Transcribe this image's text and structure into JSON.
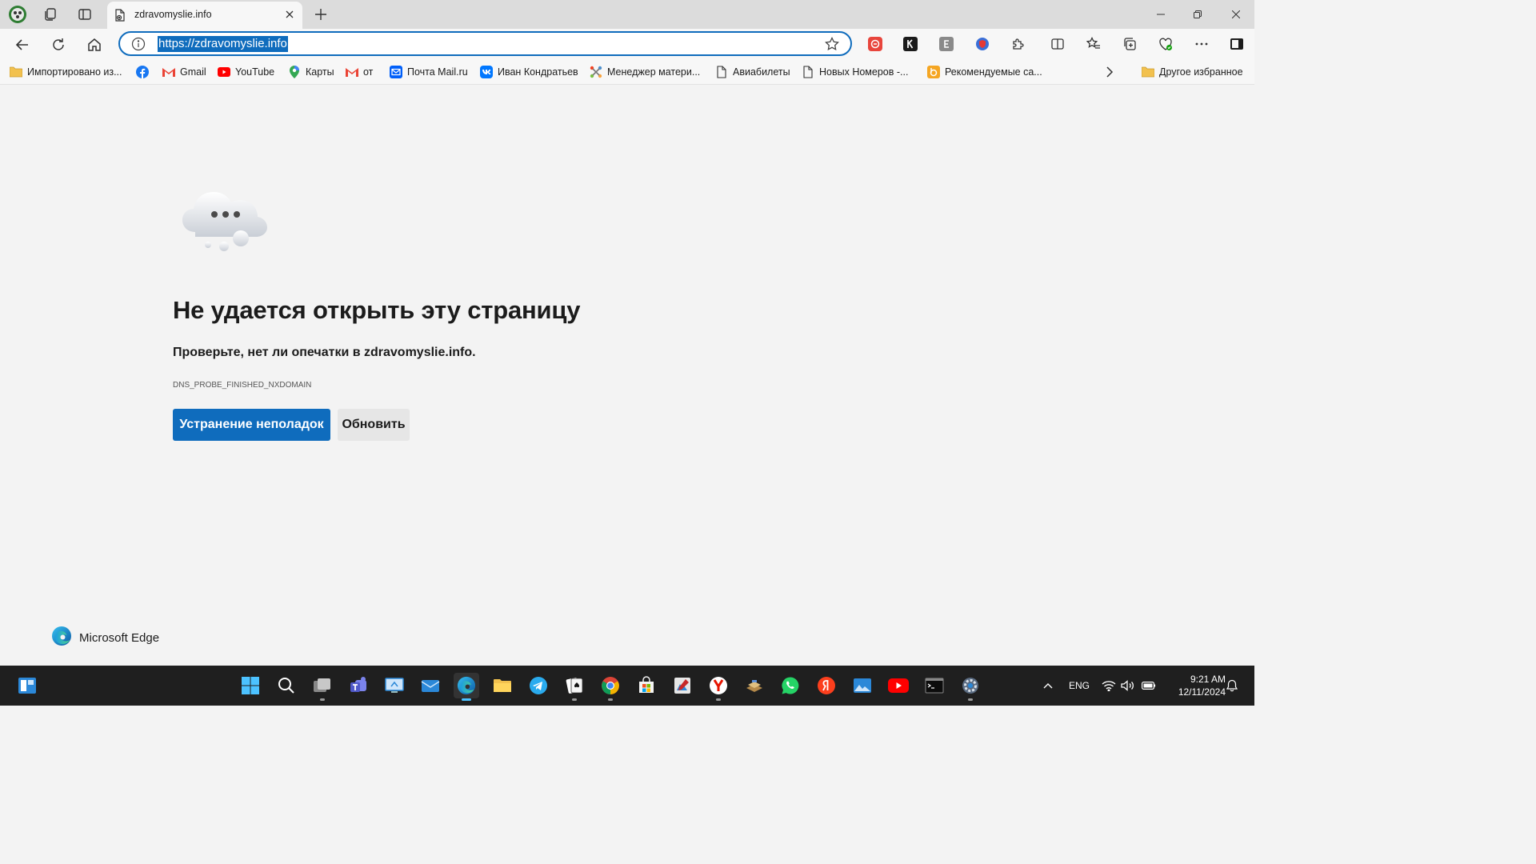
{
  "browser": {
    "tab": {
      "title": "zdravomyslie.info"
    },
    "omnibox": {
      "url": "https://zdravomyslie.info"
    },
    "favorites": [
      {
        "label": "Импортировано из...",
        "icon": "folder-icon"
      },
      {
        "label": "",
        "icon": "facebook-icon"
      },
      {
        "label": "Gmail",
        "icon": "gmail-icon"
      },
      {
        "label": "YouTube",
        "icon": "youtube-icon"
      },
      {
        "label": "Карты",
        "icon": "maps-icon"
      },
      {
        "label": "от",
        "icon": "gmail-icon"
      },
      {
        "label": "Почта Mail.ru",
        "icon": "mail-ru-icon"
      },
      {
        "label": "Иван Кондратьев",
        "icon": "vk-icon"
      },
      {
        "label": "Менеджер матери...",
        "icon": "joomla-icon"
      },
      {
        "label": "Авиабилеты",
        "icon": "page-icon"
      },
      {
        "label": "Новых Номеров -...",
        "icon": "page-icon"
      },
      {
        "label": "Рекомендуемые са...",
        "icon": "bing-icon"
      }
    ],
    "other_favorites": "Другое избранное"
  },
  "error_page": {
    "title": "Не удается открыть эту страницу",
    "subtitle": "Проверьте, нет ли опечатки в zdravomyslie.info.",
    "code": "DNS_PROBE_FINISHED_NXDOMAIN",
    "troubleshoot_label": "Устранение неполадок",
    "refresh_label": "Обновить",
    "brand": "Microsoft Edge"
  },
  "taskbar": {
    "language": "ENG",
    "time": "9:21 AM",
    "date": "12/11/2024"
  },
  "colors": {
    "accent": "#0f6cbd",
    "background": "#f3f3f3",
    "taskbar": "#1f1f1f"
  }
}
